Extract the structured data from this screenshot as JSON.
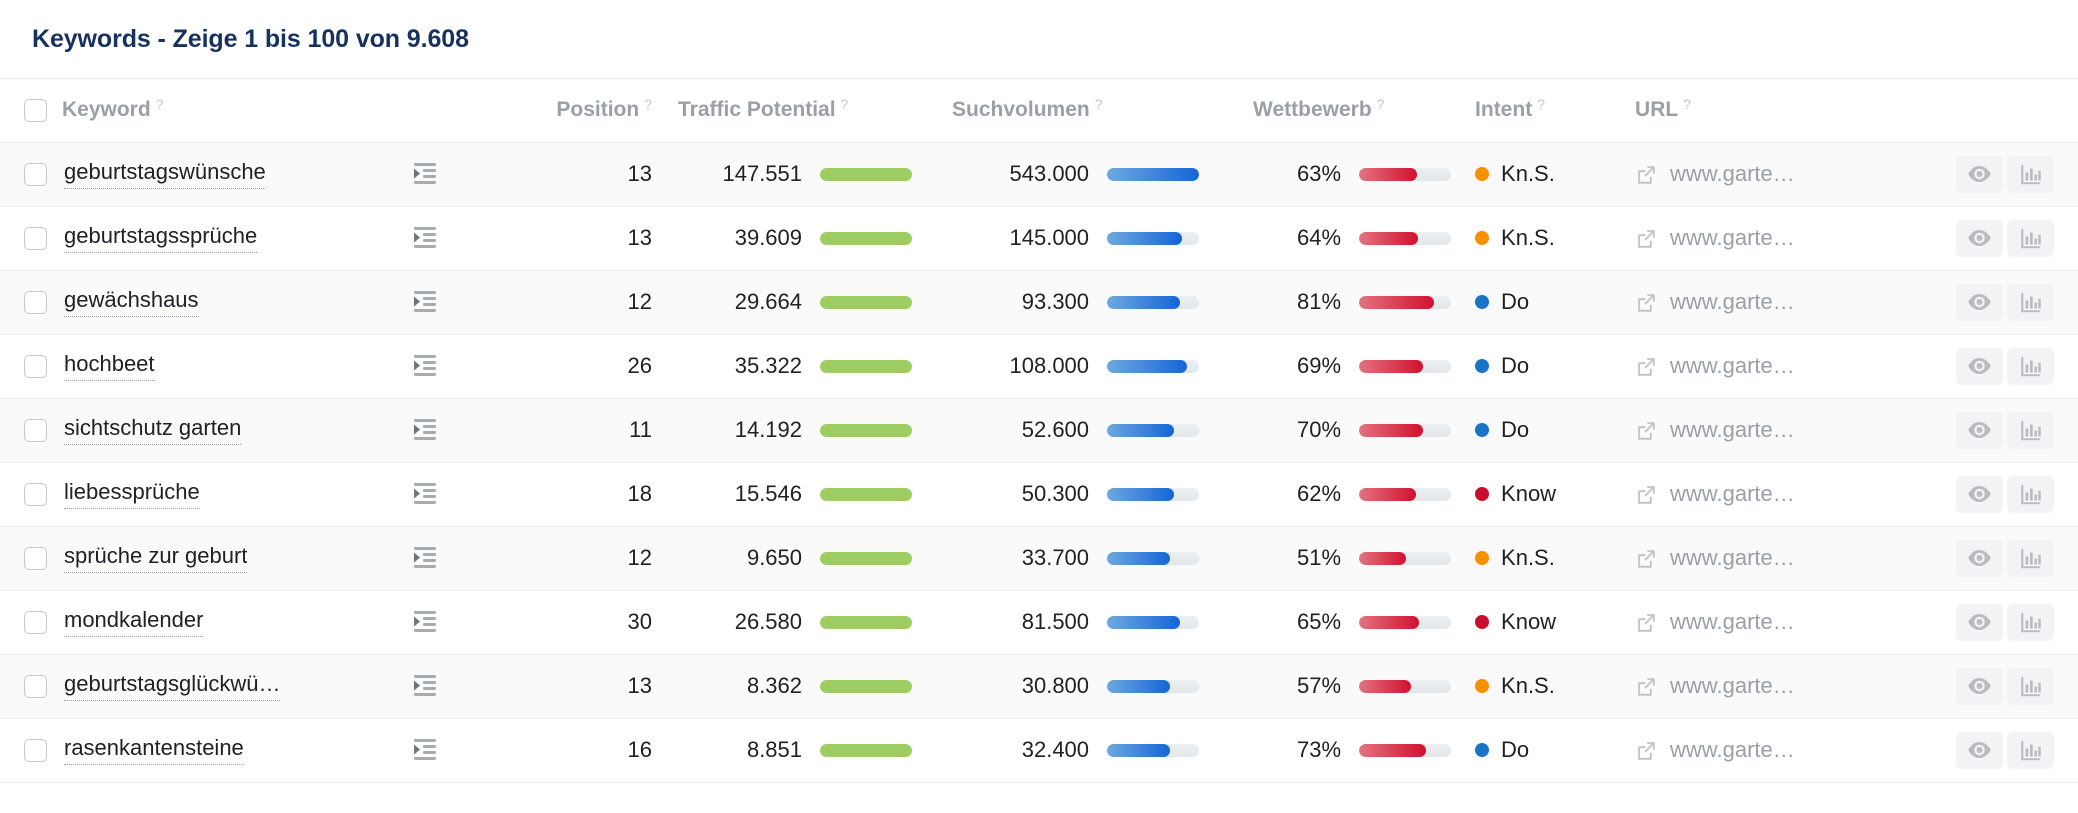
{
  "header": {
    "title": "Keywords - Zeige 1 bis 100 von 9.608"
  },
  "table": {
    "select_all_checkbox": "",
    "columns": [
      {
        "label": "Keyword",
        "help": "?"
      },
      {
        "label": "Position",
        "help": "?"
      },
      {
        "label": "Traffic Potential",
        "help": "?"
      },
      {
        "label": "Suchvolumen",
        "help": "?"
      },
      {
        "label": "Wettbewerb",
        "help": "?"
      },
      {
        "label": "Intent",
        "help": "?"
      },
      {
        "label": "URL",
        "help": "?"
      }
    ],
    "intent_colors": {
      "Kn.S.": "#f99000",
      "Do": "#1a73c8",
      "Know": "#c8102e"
    },
    "accent_colors": {
      "title": "#17325e",
      "green": "#9ccc62",
      "blue": "#1565d8",
      "red": "#d01130"
    },
    "rows": [
      {
        "keyword": "geburtstagswünsche",
        "position": "13",
        "traffic_potential": "147.551",
        "traffic_bar_pct": 100,
        "suchvolumen": "543.000",
        "suchvolumen_bar_pct": 100,
        "wettbewerb": "63%",
        "wettbewerb_bar_pct": 63,
        "intent": "Kn.S.",
        "url": "www.garte…"
      },
      {
        "keyword": "geburtstagssprüche",
        "position": "13",
        "traffic_potential": "39.609",
        "traffic_bar_pct": 100,
        "suchvolumen": "145.000",
        "suchvolumen_bar_pct": 82,
        "wettbewerb": "64%",
        "wettbewerb_bar_pct": 64,
        "intent": "Kn.S.",
        "url": "www.garte…"
      },
      {
        "keyword": "gewächshaus",
        "position": "12",
        "traffic_potential": "29.664",
        "traffic_bar_pct": 100,
        "suchvolumen": "93.300",
        "suchvolumen_bar_pct": 79,
        "wettbewerb": "81%",
        "wettbewerb_bar_pct": 81,
        "intent": "Do",
        "url": "www.garte…"
      },
      {
        "keyword": "hochbeet",
        "position": "26",
        "traffic_potential": "35.322",
        "traffic_bar_pct": 100,
        "suchvolumen": "108.000",
        "suchvolumen_bar_pct": 87,
        "wettbewerb": "69%",
        "wettbewerb_bar_pct": 69,
        "intent": "Do",
        "url": "www.garte…"
      },
      {
        "keyword": "sichtschutz garten",
        "position": "11",
        "traffic_potential": "14.192",
        "traffic_bar_pct": 100,
        "suchvolumen": "52.600",
        "suchvolumen_bar_pct": 73,
        "wettbewerb": "70%",
        "wettbewerb_bar_pct": 70,
        "intent": "Do",
        "url": "www.garte…"
      },
      {
        "keyword": "liebessprüche",
        "position": "18",
        "traffic_potential": "15.546",
        "traffic_bar_pct": 100,
        "suchvolumen": "50.300",
        "suchvolumen_bar_pct": 73,
        "wettbewerb": "62%",
        "wettbewerb_bar_pct": 62,
        "intent": "Know",
        "url": "www.garte…"
      },
      {
        "keyword": "sprüche zur geburt",
        "position": "12",
        "traffic_potential": "9.650",
        "traffic_bar_pct": 100,
        "suchvolumen": "33.700",
        "suchvolumen_bar_pct": 68,
        "wettbewerb": "51%",
        "wettbewerb_bar_pct": 51,
        "intent": "Kn.S.",
        "url": "www.garte…"
      },
      {
        "keyword": "mondkalender",
        "position": "30",
        "traffic_potential": "26.580",
        "traffic_bar_pct": 100,
        "suchvolumen": "81.500",
        "suchvolumen_bar_pct": 79,
        "wettbewerb": "65%",
        "wettbewerb_bar_pct": 65,
        "intent": "Know",
        "url": "www.garte…"
      },
      {
        "keyword": "geburtstagsglückwü…",
        "position": "13",
        "traffic_potential": "8.362",
        "traffic_bar_pct": 100,
        "suchvolumen": "30.800",
        "suchvolumen_bar_pct": 68,
        "wettbewerb": "57%",
        "wettbewerb_bar_pct": 57,
        "intent": "Kn.S.",
        "url": "www.garte…"
      },
      {
        "keyword": "rasenkantensteine",
        "position": "16",
        "traffic_potential": "8.851",
        "traffic_bar_pct": 100,
        "suchvolumen": "32.400",
        "suchvolumen_bar_pct": 68,
        "wettbewerb": "73%",
        "wettbewerb_bar_pct": 73,
        "intent": "Do",
        "url": "www.garte…"
      }
    ],
    "row_actions": [
      {
        "icon": "eye-icon"
      },
      {
        "icon": "bar-chart-icon"
      }
    ]
  }
}
